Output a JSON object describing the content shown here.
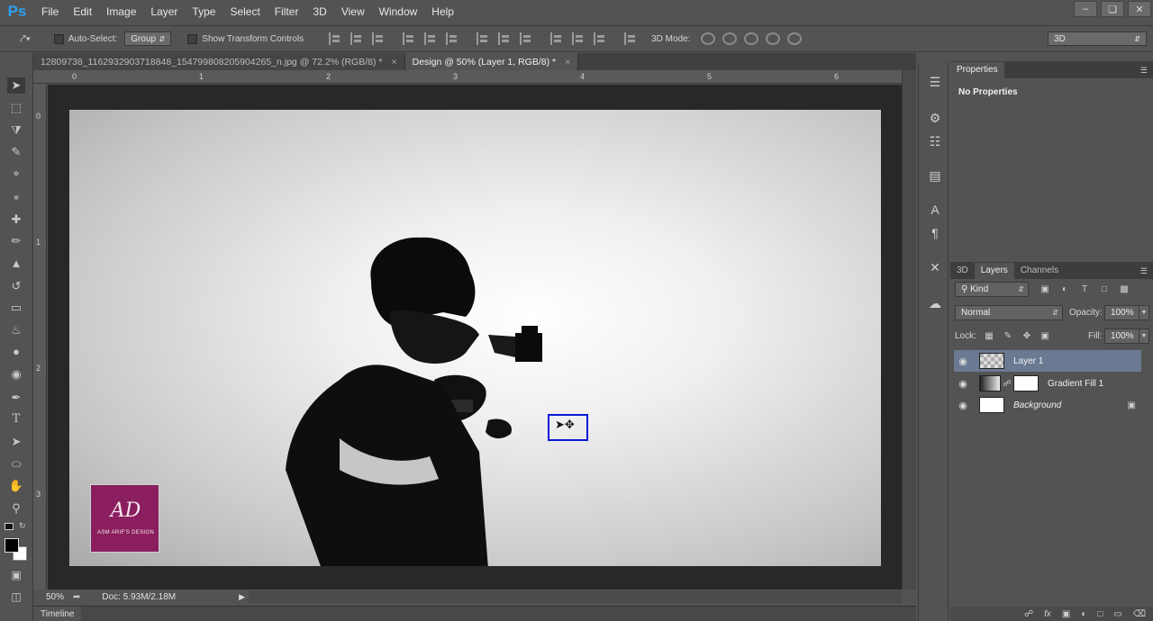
{
  "app": {
    "logo": "Ps"
  },
  "menu": [
    "File",
    "Edit",
    "Image",
    "Layer",
    "Type",
    "Select",
    "Filter",
    "3D",
    "View",
    "Window",
    "Help"
  ],
  "window_controls": [
    "minimize-icon",
    "restore-icon",
    "close-icon"
  ],
  "options": {
    "auto_select_label": "Auto-Select:",
    "auto_select_value": "Group",
    "transform_label": "Show Transform Controls",
    "mode3d_label": "3D Mode:",
    "workspace": "3D"
  },
  "tabs": [
    {
      "label": "12809738_1162932903718848_154799808205904265_n.jpg @ 72.2% (RGB/8) *",
      "active": false
    },
    {
      "label": "Design @ 50% (Layer 1, RGB/8) *",
      "active": true
    }
  ],
  "ruler": {
    "top": [
      "0",
      "1",
      "2",
      "3",
      "4",
      "5",
      "6"
    ],
    "left": [
      "0",
      "1",
      "2",
      "3"
    ]
  },
  "canvas": {
    "logo_mark": "AD",
    "logo_text": "ASM ARIF'S DESIGN"
  },
  "status": {
    "zoom": "50%",
    "doc": "Doc: 5.93M/2.18M"
  },
  "timeline": "Timeline",
  "properties": {
    "tab": "Properties",
    "message": "No Properties"
  },
  "layers_panel": {
    "tabs": [
      "3D",
      "Layers",
      "Channels"
    ],
    "active_tab": "Layers",
    "filter_kind": "Kind",
    "blend_mode": "Normal",
    "opacity_label": "Opacity:",
    "opacity": "100%",
    "lock_label": "Lock:",
    "fill_label": "Fill:",
    "fill": "100%",
    "layers": [
      {
        "name": "Layer 1",
        "thumb": "checker",
        "selected": true,
        "mask": false,
        "locked": false,
        "italic": false
      },
      {
        "name": "Gradient Fill 1",
        "thumb": "grad",
        "selected": false,
        "mask": true,
        "locked": false,
        "italic": false
      },
      {
        "name": "Background",
        "thumb": "white",
        "selected": false,
        "mask": false,
        "locked": true,
        "italic": true
      }
    ]
  },
  "colors": {
    "ui_bg": "#535353",
    "canvas_bg": "#282828",
    "accent_selected_layer": "#6b7a92",
    "logo_bg": "#8a1e5e",
    "cursor_box": "#0a1ad8",
    "ps_blue": "#2da0f0"
  }
}
